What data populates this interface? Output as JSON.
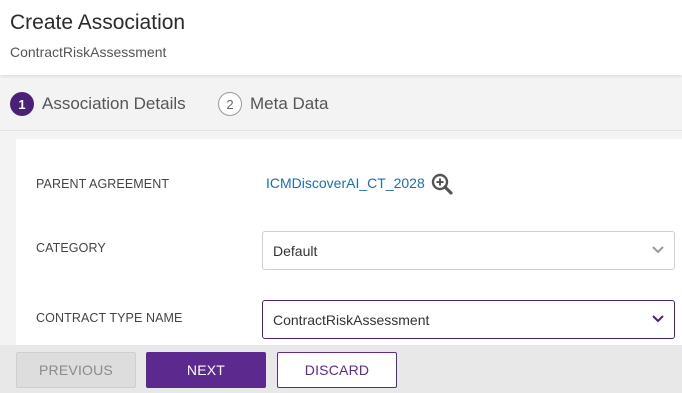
{
  "header": {
    "title": "Create Association",
    "subtitle": "ContractRiskAssessment"
  },
  "steps": [
    {
      "number": "1",
      "label": "Association Details",
      "active": true
    },
    {
      "number": "2",
      "label": "Meta Data",
      "active": false
    }
  ],
  "form": {
    "parent_agreement": {
      "label": "PARENT AGREEMENT",
      "value": "ICMDiscoverAI_CT_2028",
      "icon": "zoom-in-icon"
    },
    "category": {
      "label": "CATEGORY",
      "value": "Default",
      "icon": "chevron-down-icon"
    },
    "contract_type_name": {
      "label": "CONTRACT TYPE NAME",
      "value": "ContractRiskAssessment",
      "icon": "chevron-down-icon"
    }
  },
  "footer": {
    "previous_label": "PREVIOUS",
    "next_label": "NEXT",
    "discard_label": "DISCARD"
  },
  "colors": {
    "accent": "#5c2a8e",
    "step_active": "#4b2079",
    "link": "#1a6fb5"
  }
}
